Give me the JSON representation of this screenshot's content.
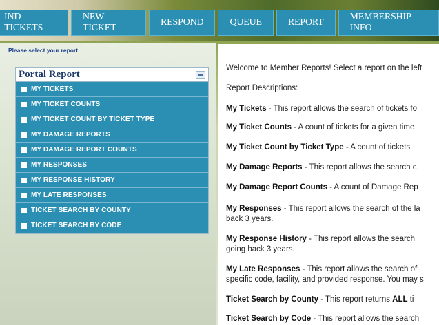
{
  "nav": {
    "items": [
      "IND TICKETS",
      "NEW TICKET",
      "RESPOND",
      "QUEUE",
      "REPORT",
      "MEMBERSHIP INFO"
    ]
  },
  "left": {
    "prompt": "Please select your report",
    "portal_title": "Portal Report",
    "items": [
      "MY TICKETS",
      "MY TICKET COUNTS",
      "MY TICKET COUNT BY TICKET TYPE",
      "MY DAMAGE REPORTS",
      "MY DAMAGE REPORT COUNTS",
      "MY RESPONSES",
      "MY RESPONSE HISTORY",
      "MY LATE RESPONSES",
      "TICKET SEARCH BY COUNTY",
      "TICKET SEARCH BY CODE"
    ]
  },
  "right": {
    "welcome": "Welcome to Member Reports! Select a report on the left",
    "descriptions_label": "Report Descriptions:",
    "descs": [
      {
        "title": "My Tickets",
        "text": " - This report allows the search of tickets fo"
      },
      {
        "title": "My Ticket Counts",
        "text": " - A count of tickets for a given time"
      },
      {
        "title": "My Ticket Count by Ticket Type",
        "text": " - A count of tickets"
      },
      {
        "title": "My Damage Reports",
        "text": " - This report allows the search c"
      },
      {
        "title": "My Damage Report Counts",
        "text": " - A count of Damage Rep"
      },
      {
        "title": "My Responses",
        "text": " - This report allows the search of the la",
        "cont": "back 3 years."
      },
      {
        "title": "My Response History",
        "text": " - This report allows the search",
        "cont": "going back 3 years."
      },
      {
        "title": "My Late Responses",
        "text": " - This report allows the search of",
        "cont": "specific code, facility, and provided response. You may s"
      },
      {
        "title": "Ticket Search by County",
        "text": " - This report returns ",
        "bold2": "ALL",
        "text2": " ti"
      },
      {
        "title": "Ticket Search by Code",
        "text": " - This report allows the search"
      }
    ]
  }
}
